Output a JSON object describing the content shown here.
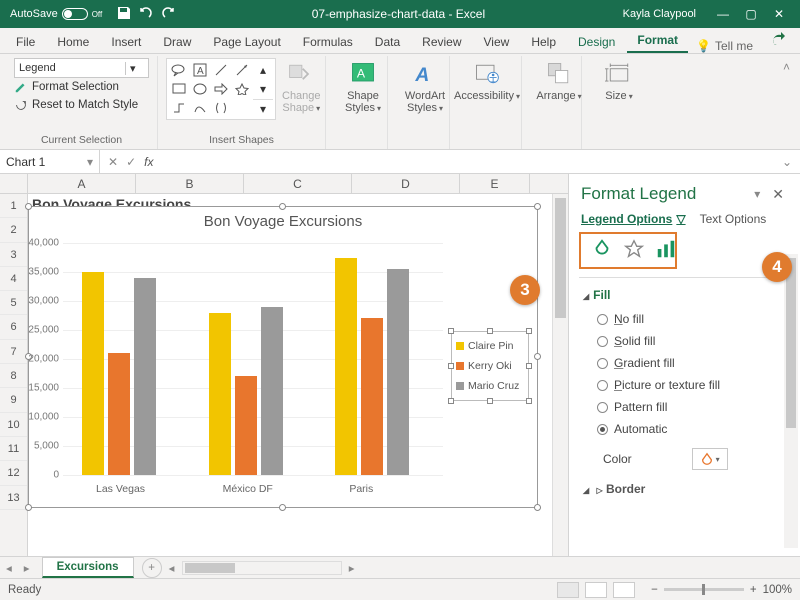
{
  "titlebar": {
    "autosave": "AutoSave",
    "autosave_state": "Off",
    "doc": "07-emphasize-chart-data - Excel",
    "user": "Kayla Claypool"
  },
  "tabs": [
    "File",
    "Home",
    "Insert",
    "Draw",
    "Page Layout",
    "Formulas",
    "Data",
    "Review",
    "View",
    "Help"
  ],
  "ctx_tabs": [
    "Design",
    "Format"
  ],
  "tellme": "Tell me",
  "ribbon": {
    "selection_dd": "Legend",
    "format_selection": "Format Selection",
    "reset": "Reset to Match Style",
    "group1": "Current Selection",
    "change_shape": "Change Shape",
    "group2": "Insert Shapes",
    "shape_styles": "Shape Styles",
    "wordart": "WordArt Styles",
    "accessibility": "Accessibility",
    "arrange": "Arrange",
    "size": "Size"
  },
  "namebox": "Chart 1",
  "columns": [
    "A",
    "B",
    "C",
    "D",
    "E"
  ],
  "rows": [
    "1",
    "2",
    "3",
    "4",
    "5",
    "6",
    "7",
    "8",
    "9",
    "10",
    "11",
    "12",
    "13"
  ],
  "cell_a1": "Bon Voyage Excursions",
  "chart_data": {
    "type": "bar",
    "title": "Bon Voyage Excursions",
    "categories": [
      "Las Vegas",
      "México DF",
      "Paris"
    ],
    "series": [
      {
        "name": "Claire Pin",
        "color": "#f2c500",
        "values": [
          35000,
          28000,
          37500
        ]
      },
      {
        "name": "Kerry Oki",
        "color": "#e8762d",
        "values": [
          21000,
          17000,
          27000
        ]
      },
      {
        "name": "Mario Cruz",
        "color": "#9a9a9a",
        "values": [
          34000,
          29000,
          35500
        ]
      }
    ],
    "ylim": [
      0,
      40000
    ],
    "yticks": [
      0,
      5000,
      10000,
      15000,
      20000,
      25000,
      30000,
      35000,
      40000
    ],
    "ytick_labels": [
      "0",
      "5,000",
      "10,000",
      "15,000",
      "20,000",
      "25,000",
      "30,000",
      "35,000",
      "40,000"
    ]
  },
  "pane": {
    "title": "Format Legend",
    "tab1": "Legend Options",
    "tab2": "Text Options",
    "section": "Fill",
    "opts": [
      "No fill",
      "Solid fill",
      "Gradient fill",
      "Picture or texture fill",
      "Pattern fill",
      "Automatic"
    ],
    "opt_hot": [
      "N",
      "S",
      "G",
      "P",
      "A",
      "U"
    ],
    "selected": 5,
    "color_label": "Color",
    "next_section": "Border"
  },
  "sheet_tab": "Excursions",
  "status": "Ready",
  "zoom": "100%",
  "callouts": {
    "c3": "3",
    "c4": "4"
  }
}
